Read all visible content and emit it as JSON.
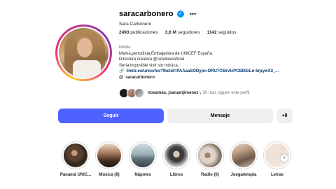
{
  "profile": {
    "username": "saracarbonero",
    "full_name": "Sara Carbonero",
    "verified_icon": "verified-check-icon",
    "more_icon": "more-options-icon"
  },
  "stats": {
    "posts_count": "2493",
    "posts_label": "publicaciones",
    "followers_count": "3,6 M",
    "followers_label": "seguidores",
    "following_count": "1142",
    "following_label": "seguidos"
  },
  "bio": {
    "category": "Media",
    "line1": "Mamá,periodista,Embajadora de UNICEF España.",
    "line2": "Directora creativa @slowloveoficial .",
    "line3": "Sería imposible vivir sin música.",
    "link": "linktr.ee/unicefes?fbclid=PAAaaSODypn-DRU7C6bVlzPCBDEiLn-5rpywX3_...",
    "threads_handle": "saracarbonero"
  },
  "followed_by": {
    "names": "novamas, joanamjimenez",
    "rest": " y 30 más siguen este perfil"
  },
  "actions": {
    "follow": "Seguir",
    "message": "Mensaje",
    "add_user_icon": "+8"
  },
  "highlights": [
    {
      "label": "Panamá UNIC..."
    },
    {
      "label": "Música (II)"
    },
    {
      "label": "Nápoles"
    },
    {
      "label": "Libros"
    },
    {
      "label": "Radio (II)"
    },
    {
      "label": "Juegaterapia"
    },
    {
      "label": "Letras"
    }
  ],
  "colors": {
    "follow_button": "#4f61ff",
    "secondary_button": "#efefef",
    "verified": "#0095f6",
    "link": "#00376b"
  }
}
